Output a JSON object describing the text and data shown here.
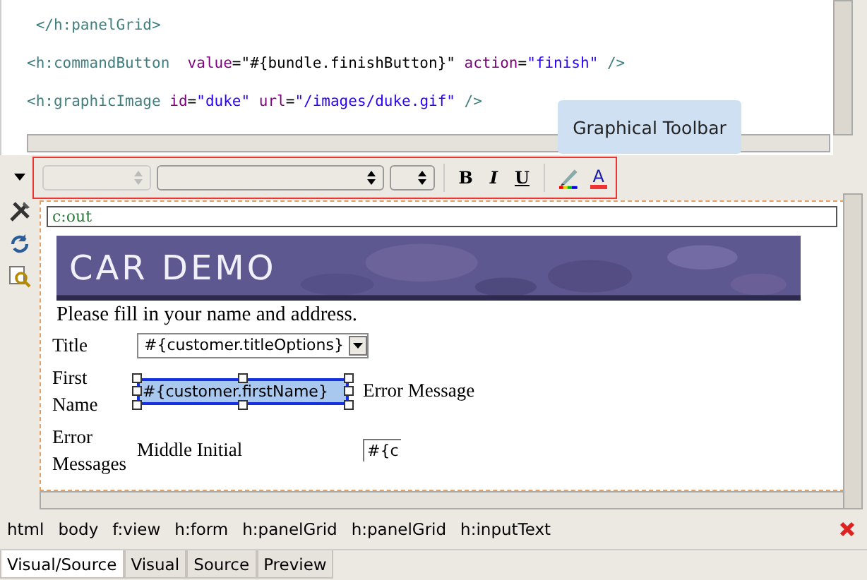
{
  "source": {
    "lines": [
      [
        {
          "kind": "tag",
          "text": " </h:panelGrid>"
        }
      ],
      [
        {
          "kind": "tag",
          "text": "<h:commandButton"
        },
        {
          "kind": "attr",
          "text": "  value"
        },
        {
          "kind": "plain",
          "text": "=\"#{bundle.finishButton}\""
        },
        {
          "kind": "attr",
          "text": " action"
        },
        {
          "kind": "plain",
          "text": "="
        },
        {
          "kind": "value",
          "text": "\"finish\""
        },
        {
          "kind": "tag",
          "text": " />"
        }
      ],
      [
        {
          "kind": "tag",
          "text": "<h:graphicImage"
        },
        {
          "kind": "attr",
          "text": " id"
        },
        {
          "kind": "plain",
          "text": "="
        },
        {
          "kind": "value",
          "text": "\"duke\""
        },
        {
          "kind": "attr",
          "text": " url"
        },
        {
          "kind": "plain",
          "text": "="
        },
        {
          "kind": "value",
          "text": "\"/images/duke.gif\""
        },
        {
          "kind": "tag",
          "text": " />"
        }
      ]
    ]
  },
  "tooltip": "Graphical Toolbar",
  "toolbar": {
    "combos": [
      {
        "disabled": true
      },
      {
        "disabled": false
      },
      {
        "disabled": false
      }
    ],
    "buttons": [
      {
        "kind": "bold",
        "label": "B"
      },
      {
        "kind": "italic",
        "label": "I"
      },
      {
        "kind": "underline",
        "label": "U"
      },
      {
        "kind": "highlight"
      },
      {
        "kind": "font-color",
        "label": "A"
      }
    ]
  },
  "visual": {
    "tag_field": "c:out",
    "banner": "CAR DEMO",
    "intro": "Please fill in your name and address.",
    "form": [
      {
        "label": "Title",
        "kind": "select",
        "value": "#{customer.titleOptions}"
      },
      {
        "label": "First Name",
        "kind": "input",
        "value": "#{customer.firstName}",
        "selected": true,
        "message": "Error Message"
      },
      {
        "label": "Error Messages",
        "kind": "input",
        "field_label": "Middle Initial",
        "value": "#{c",
        "selected": false
      }
    ]
  },
  "breadcrumb": [
    "html",
    "body",
    "f:view",
    "h:form",
    "h:panelGrid",
    "h:panelGrid",
    "h:inputText"
  ],
  "tabs": [
    {
      "label": "Visual/Source",
      "selected": true
    },
    {
      "label": "Visual",
      "selected": false
    },
    {
      "label": "Source",
      "selected": false
    },
    {
      "label": "Preview",
      "selected": false
    }
  ]
}
